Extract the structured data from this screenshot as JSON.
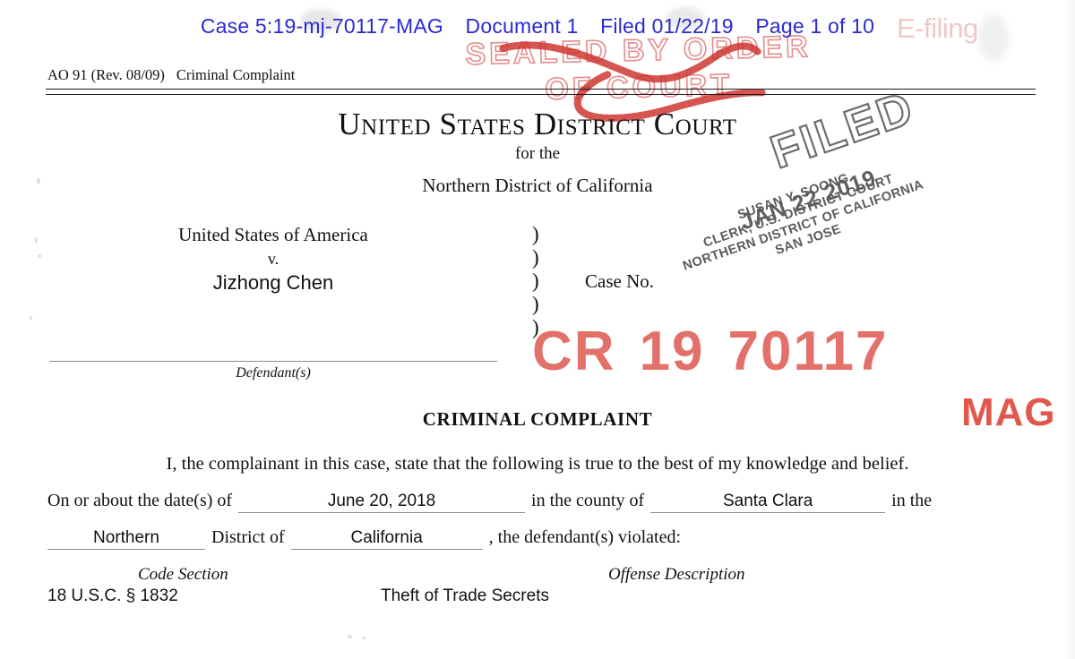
{
  "ecf_header": {
    "case": "Case 5:19-mj-70117-MAG",
    "document": "Document 1",
    "filed": "Filed 01/22/19",
    "page": "Page 1 of 10",
    "efiling": "E-filing",
    "color": "#2a2ad0"
  },
  "seal_stamp": {
    "line1": "SEALED BY ORDER",
    "line2": "OF COURT",
    "color": "#d85656"
  },
  "form": {
    "form_id": "AO 91 (Rev. 08/09)",
    "form_title": "Criminal Complaint"
  },
  "court": {
    "title": "United States District Court",
    "for_the": "for the",
    "district": "Northern District of California"
  },
  "caption": {
    "plaintiff": "United States of America",
    "versus": "v.",
    "defendant": "Jizhong Chen",
    "parens": ")\n)\n)\n)\n)",
    "case_no_label": "Case No.",
    "defendant_caption": "Defendant(s)"
  },
  "filed_stamp": {
    "word": "FILED",
    "date": "JAN 22 2019",
    "clerk_name": "SUSAN Y. SOONG",
    "clerk_title": "CLERK, U.S. DISTRICT COURT",
    "clerk_district": "NORTHERN DISTRICT OF CALIFORNIA",
    "clerk_division": "SAN JOSE",
    "color": "#5d5d5d"
  },
  "case_number_stamp": {
    "prefix": "CR",
    "year": "19",
    "number": "70117",
    "suffix": "MAG",
    "color": "#e06a62"
  },
  "complaint": {
    "title": "CRIMINAL COMPLAINT",
    "attestation": "I, the complainant in this case, state that the following is true to the best of my knowledge and belief.",
    "label_on_or_about": "On or about the date(s) of",
    "value_date": "June 20, 2018",
    "label_in_the_county": "in the county of",
    "value_county": "Santa Clara",
    "label_in_the": "in the",
    "value_district": "Northern",
    "label_district_of": "District of",
    "value_state": "California",
    "label_defendant_violated": ", the defendant(s) violated:"
  },
  "charges_table": {
    "header_code": "Code Section",
    "header_offense": "Offense Description",
    "rows": [
      {
        "code": "18 U.S.C. § 1832",
        "offense": "Theft of Trade Secrets"
      }
    ]
  }
}
